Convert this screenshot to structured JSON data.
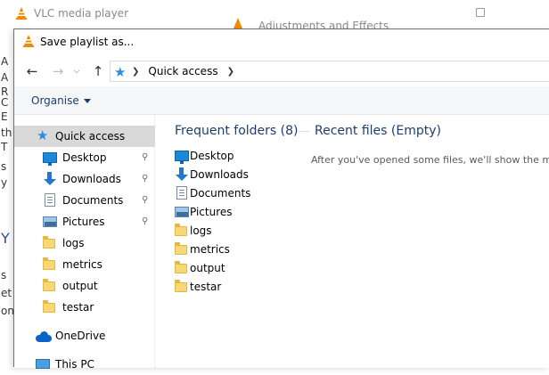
{
  "background_window": {
    "title": "VLC media player",
    "secondary_title": "Adjustments and Effects",
    "side_letters": [
      "A",
      "A",
      "R",
      "C",
      "E",
      "th",
      "T",
      "s",
      "y",
      "Y",
      "s",
      "et",
      "on"
    ]
  },
  "dialog": {
    "title": "Save playlist as...",
    "address": {
      "location": "Quick access"
    },
    "toolbar": {
      "organise_label": "Organise"
    },
    "nav_pane": {
      "items": [
        {
          "label": "Quick access",
          "icon": "star-icon",
          "selected": true,
          "pinned": false
        },
        {
          "label": "Desktop",
          "icon": "desktop-icon",
          "selected": false,
          "pinned": true
        },
        {
          "label": "Downloads",
          "icon": "downloads-icon",
          "selected": false,
          "pinned": true
        },
        {
          "label": "Documents",
          "icon": "documents-icon",
          "selected": false,
          "pinned": true
        },
        {
          "label": "Pictures",
          "icon": "pictures-icon",
          "selected": false,
          "pinned": true
        },
        {
          "label": "logs",
          "icon": "folder-icon",
          "selected": false,
          "pinned": false
        },
        {
          "label": "metrics",
          "icon": "folder-icon",
          "selected": false,
          "pinned": false
        },
        {
          "label": "output",
          "icon": "folder-icon",
          "selected": false,
          "pinned": false
        },
        {
          "label": "testar",
          "icon": "folder-icon",
          "selected": false,
          "pinned": false
        },
        {
          "label": "OneDrive",
          "icon": "cloud-icon",
          "selected": false,
          "pinned": false
        },
        {
          "label": "This PC",
          "icon": "pc-icon",
          "selected": false,
          "pinned": false
        }
      ]
    },
    "content": {
      "frequent_header": "Frequent folders (8)",
      "recent_header": "Recent files (Empty)",
      "recent_message": "After you've opened some files, we'll show the mo",
      "frequent_folders": [
        {
          "label": "Desktop",
          "icon": "desktop-icon"
        },
        {
          "label": "Downloads",
          "icon": "downloads-icon"
        },
        {
          "label": "Documents",
          "icon": "documents-icon"
        },
        {
          "label": "Pictures",
          "icon": "pictures-icon"
        },
        {
          "label": "logs",
          "icon": "folder-icon"
        },
        {
          "label": "metrics",
          "icon": "folder-icon"
        },
        {
          "label": "output",
          "icon": "folder-icon"
        },
        {
          "label": "testar",
          "icon": "folder-icon"
        }
      ]
    }
  },
  "colors": {
    "vlc_orange": "#f08a00",
    "header_blue": "#1e3d6b",
    "selection_gray": "#d9d9d9",
    "accent_blue": "#2a8be0"
  }
}
